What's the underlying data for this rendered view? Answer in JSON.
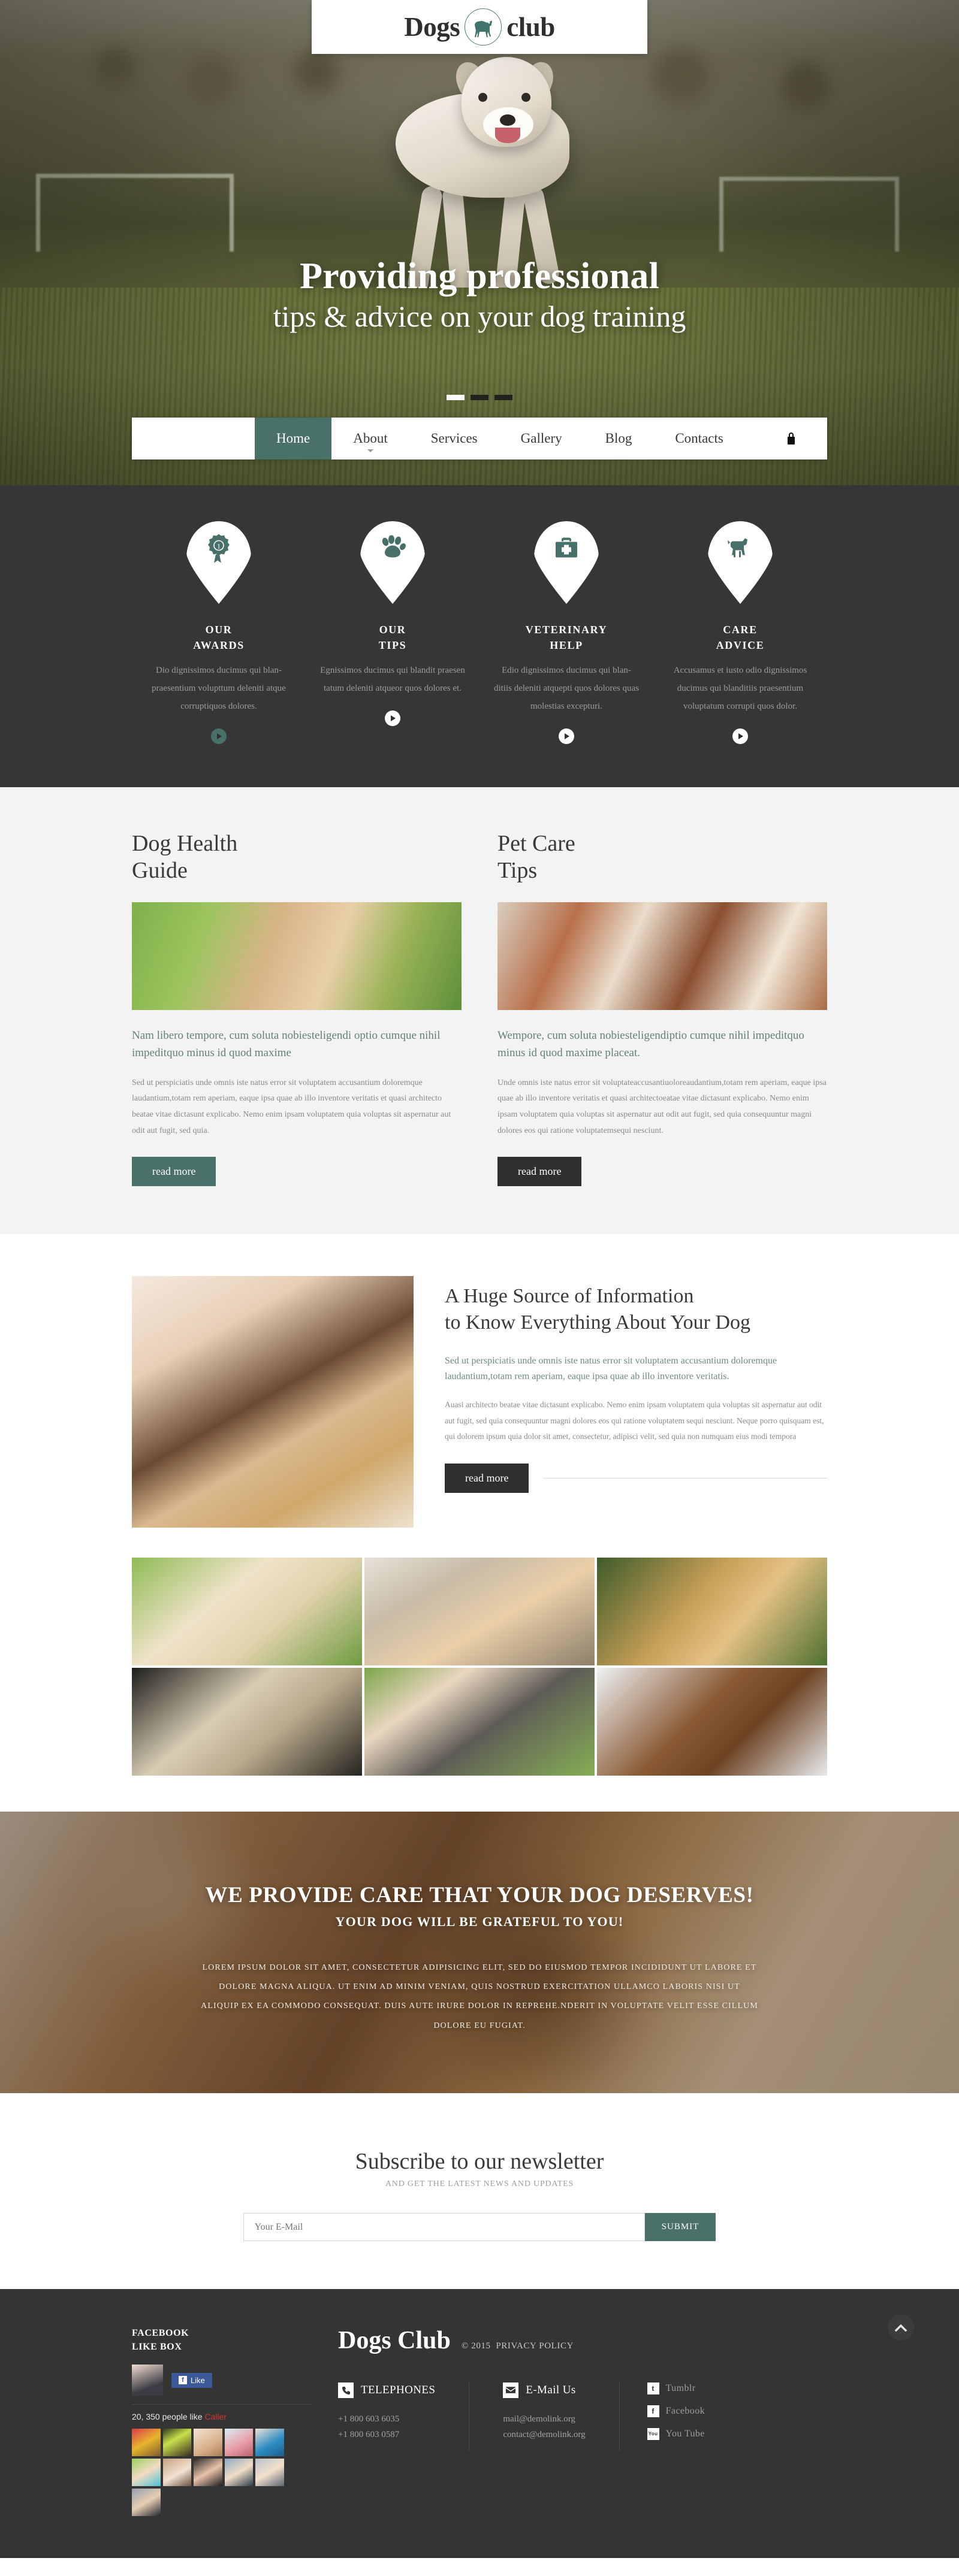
{
  "brand": {
    "part1": "Dogs",
    "part2": "club",
    "icon": "dog-silhouette-icon",
    "accent": "#4a706a"
  },
  "hero": {
    "title": "Providing professional",
    "subtitle": "tips & advice on your dog training",
    "slides_total": 3,
    "active_slide": 1
  },
  "nav": {
    "items": [
      {
        "label": "Home",
        "active": true,
        "dropdown": false
      },
      {
        "label": "About",
        "active": false,
        "dropdown": true
      },
      {
        "label": "Services",
        "active": false,
        "dropdown": false
      },
      {
        "label": "Gallery",
        "active": false,
        "dropdown": false
      },
      {
        "label": "Blog",
        "active": false,
        "dropdown": false
      },
      {
        "label": "Contacts",
        "active": false,
        "dropdown": false
      }
    ],
    "lock_icon": "lock-icon"
  },
  "features": [
    {
      "icon": "award-ribbon-icon",
      "title_l1": "OUR",
      "title_l2": "AWARDS",
      "text": "Dio dignissimos ducimus qui blan- praesentium volupttum deleniti atque corruptiquos dolores.",
      "play_label": "play-button",
      "play_style": "teal"
    },
    {
      "icon": "paw-print-icon",
      "title_l1": "OUR",
      "title_l2": "TIPS",
      "text": "Egnissimos ducimus qui blandit praesen tatum deleniti atqueor quos dolores et.",
      "play_label": "play-button",
      "play_style": "white"
    },
    {
      "icon": "medical-bag-icon",
      "title_l1": "VETERINARY",
      "title_l2": "HELP",
      "text": "Edio dignissimos ducimus qui blan- ditiis deleniti atquepti quos dolores quas molestias excepturi.",
      "play_label": "play-button",
      "play_style": "white"
    },
    {
      "icon": "dog-icon",
      "title_l1": "CARE",
      "title_l2": "ADVICE",
      "text": "Accusamus et iusto odio dignissimos ducimus qui blanditiis praesentium voluptatum corrupti quos dolor.",
      "play_label": "play-button",
      "play_style": "white"
    }
  ],
  "articles": [
    {
      "heading_l1": "Dog Health",
      "heading_l2": "Guide",
      "image": "girl-kissing-labrador-photo",
      "lead": "Nam libero tempore, cum soluta nobiesteligendi optio cumque nihil impeditquo minus id quod maxime",
      "body": "Sed ut perspiciatis unde omnis iste natus error sit voluptatem accusantium doloremque laudantium,totam rem aperiam, eaque ipsa quae ab illo inventore veritatis et quasi architecto beatae vitae dictasunt explicabo. Nemo enim ipsam voluptatem quia voluptas sit aspernatur aut odit aut fugit, sed quia.",
      "button": "read more",
      "button_style": "teal"
    },
    {
      "heading_l1": "Pet Care",
      "heading_l2": "Tips",
      "image": "saint-bernard-dogs-photo",
      "lead": "Wempore, cum soluta nobiesteligendiptio cumque nihil impeditquo minus id quod maxime placeat.",
      "body": "Unde omnis iste natus error sit voluptateaccusantiuoloreaudantium,totam rem aperiam, eaque ipsa quae ab illo inventore veritatis et quasi architectoeatae vitae dictasunt explicabo. Nemo enim ipsam voluptatem quia voluptas sit aspernatur aut odit aut fugit, sed quia consequuntur magni dolores eos qui ratione voluptatemsequi nesciunt.",
      "button": "read more",
      "button_style": "dark"
    }
  ],
  "info": {
    "image": "woman-holding-yorkshire-terrier-photo",
    "heading_l1": "A Huge Source of Information",
    "heading_l2": "to Know Everything About Your Dog",
    "lead": "Sed ut perspiciatis unde omnis iste natus error sit voluptatem accusantium doloremque laudantium,totam rem aperiam, eaque ipsa quae ab illo inventore veritatis.",
    "body": "Auasi architecto beatae vitae dictasunt explicabo. Nemo enim ipsam voluptatem quia voluptas sit aspernatur aut odit aut fugit, sed quia consequuntur magni dolores eos qui ratione voluptatem sequi nesciunt. Neque porro quisquam est, qui dolorem ipsum quia dolor sit amet, consectetur, adipisci velit, sed quia non numquam eius modi tempora",
    "button": "read more"
  },
  "gallery": {
    "items": [
      "two-labrador-puppies-photo",
      "woman-hugging-husky-photo",
      "german-shepherd-photo",
      "smiling-husky-photo",
      "girl-hugging-husky-in-grass-photo",
      "dog-carrying-stick-in-snow-photo"
    ]
  },
  "cta": {
    "heading": "WE PROVIDE CARE THAT YOUR DOG DESERVES!",
    "subheading": "YOUR DOG WILL BE GRATEFUL TO YOU!",
    "text": "LOREM IPSUM DOLOR SIT AMET, CONSECTETUR ADIPISICING ELIT, SED DO EIUSMOD TEMPOR INCIDIDUNT UT LABORE ET DOLORE MAGNA ALIQUA. UT ENIM AD MINIM VENIAM, QUIS NOSTRUD EXERCITATION ULLAMCO LABORIS NISI UT ALIQUIP EX EA COMMODO CONSEQUAT. DUIS AUTE IRURE DOLOR IN REPREHE.NDERIT IN VOLUPTATE VELIT ESSE CILLUM DOLORE EU FUGIAT.",
    "background": "golden-retriever-puppy-photo"
  },
  "newsletter": {
    "title": "Subscribe to our newsletter",
    "subtitle": "AND GET THE LATEST NEWS AND UPDATES",
    "placeholder": "Your E-Mail",
    "value": "",
    "submit": "SUBMIT"
  },
  "footer": {
    "facebook_box": {
      "title_l1": "FACEBOOK",
      "title_l2": "LIKE BOX",
      "like_label": "Like",
      "count_text": "20, 350 people like",
      "count_link": "Caller",
      "avatar": "woman-avatar-photo",
      "faces_count": 11
    },
    "brand": "Dogs Club",
    "copyright": "© 2015",
    "privacy": "PRIVACY POLICY",
    "telephones": {
      "icon": "phone-icon",
      "title": "TELEPHONES",
      "numbers": [
        "+1 800 603 6035",
        "+1 800 603 0587"
      ]
    },
    "email": {
      "icon": "envelope-icon",
      "title": "E-Mail Us",
      "addresses": [
        "mail@demolink.org",
        "contact@demolink.org"
      ]
    },
    "social": [
      {
        "label": "Tumblr",
        "icon": "tumblr-icon",
        "glyph": "t"
      },
      {
        "label": "Facebook",
        "icon": "facebook-icon",
        "glyph": "f"
      },
      {
        "label": "You Tube",
        "icon": "youtube-icon",
        "glyph": "You"
      }
    ],
    "back_to_top": "chevron-up-icon"
  }
}
